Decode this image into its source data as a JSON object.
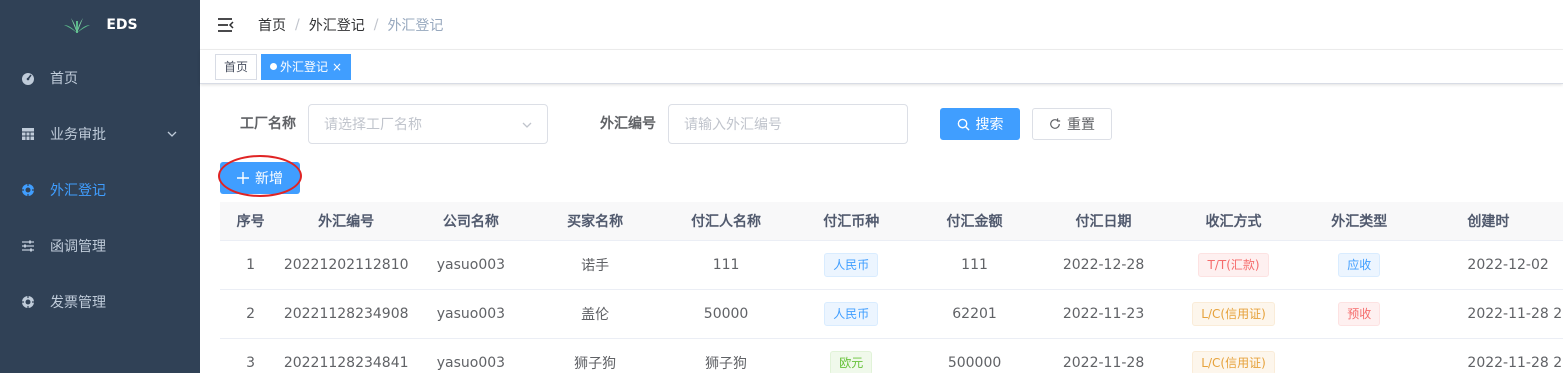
{
  "app": {
    "logo_text": "EDS"
  },
  "sidebar": {
    "items": [
      {
        "label": "首页",
        "icon": "dashboard-icon"
      },
      {
        "label": "业务审批",
        "icon": "grid-icon"
      },
      {
        "label": "外汇登记",
        "icon": "target-icon",
        "active": true
      },
      {
        "label": "函调管理",
        "icon": "sliders-icon"
      },
      {
        "label": "发票管理",
        "icon": "target-icon"
      }
    ]
  },
  "breadcrumb": {
    "home": "首页",
    "parent": "外汇登记",
    "current": "外汇登记"
  },
  "tags": {
    "home": "首页",
    "active": "外汇登记"
  },
  "search": {
    "factory_label": "工厂名称",
    "factory_placeholder": "请选择工厂名称",
    "fx_label": "外汇编号",
    "fx_placeholder": "请输入外汇编号",
    "search_btn": "搜索",
    "reset_btn": "重置"
  },
  "toolbar": {
    "add_btn": "新增"
  },
  "table": {
    "headers": [
      "序号",
      "外汇编号",
      "公司名称",
      "买家名称",
      "付汇人名称",
      "付汇币种",
      "付汇金额",
      "付汇日期",
      "收汇方式",
      "外汇类型",
      "创建时"
    ],
    "rows": [
      {
        "idx": "1",
        "fx_no": "20221202112810",
        "company": "yasuo003",
        "buyer": "诺手",
        "payer": "111",
        "currency": "人民币",
        "amount": "111",
        "date": "2022-12-28",
        "method": "T/T(汇款)",
        "type": "应收",
        "created": "2022-12-02"
      },
      {
        "idx": "2",
        "fx_no": "20221128234908",
        "company": "yasuo003",
        "buyer": "盖伦",
        "payer": "50000",
        "currency": "人民币",
        "amount": "62201",
        "date": "2022-11-23",
        "method": "L/C(信用证)",
        "type": "预收",
        "created": "2022-11-28 2"
      },
      {
        "idx": "3",
        "fx_no": "20221128234841",
        "company": "yasuo003",
        "buyer": "狮子狗",
        "payer": "狮子狗",
        "currency": "欧元",
        "amount": "500000",
        "date": "2022-11-28",
        "method": "L/C(信用证)",
        "type": "",
        "created": "2022-11-28 2"
      }
    ]
  },
  "colors": {
    "sidebar_bg": "#304156",
    "primary": "#409eff",
    "annotation_ring": "#e02424"
  }
}
